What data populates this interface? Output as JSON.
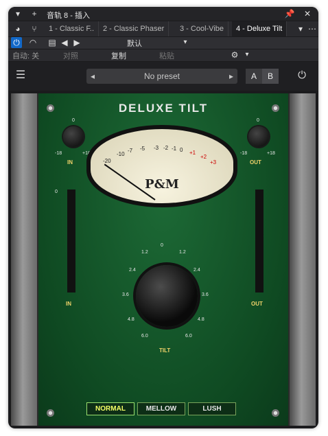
{
  "window": {
    "title": "音轨 8 - 插入",
    "tabs": [
      "1 - Classic F..",
      "2 - Classic Phaser",
      "3 - Cool-Vibe",
      "4 - Deluxe Tilt"
    ],
    "auto_label": "自动: 关",
    "preset_default": "默认",
    "compare_label": "对照",
    "copy_label": "复制",
    "paste_label": "粘贴"
  },
  "plugin": {
    "preset": "No preset",
    "a_label": "A",
    "b_label": "B",
    "name": "DELUXE TILT",
    "brand": "P&M",
    "in_label": "IN",
    "out_label": "OUT",
    "tilt_label": "TILT",
    "knob_in_min": "-18",
    "knob_in_max": "+18",
    "knob_in_top": "0",
    "knob_out_min": "-18",
    "knob_out_max": "+18",
    "knob_out_top": "0",
    "vu_scale": [
      "-20",
      "-10",
      "-7",
      "-5",
      "-3",
      "-2",
      "-1",
      "0",
      "+1",
      "+2",
      "+3"
    ],
    "meter_scale": [
      "0",
      "3",
      "6",
      "9",
      "12",
      "18",
      "30",
      "60"
    ],
    "tilt_scale": [
      "0",
      "1.2",
      "2.4",
      "3.6",
      "4.8",
      "6.0"
    ],
    "modes": [
      "NORMAL",
      "MELLOW",
      "LUSH"
    ],
    "selected_mode": "NORMAL"
  }
}
